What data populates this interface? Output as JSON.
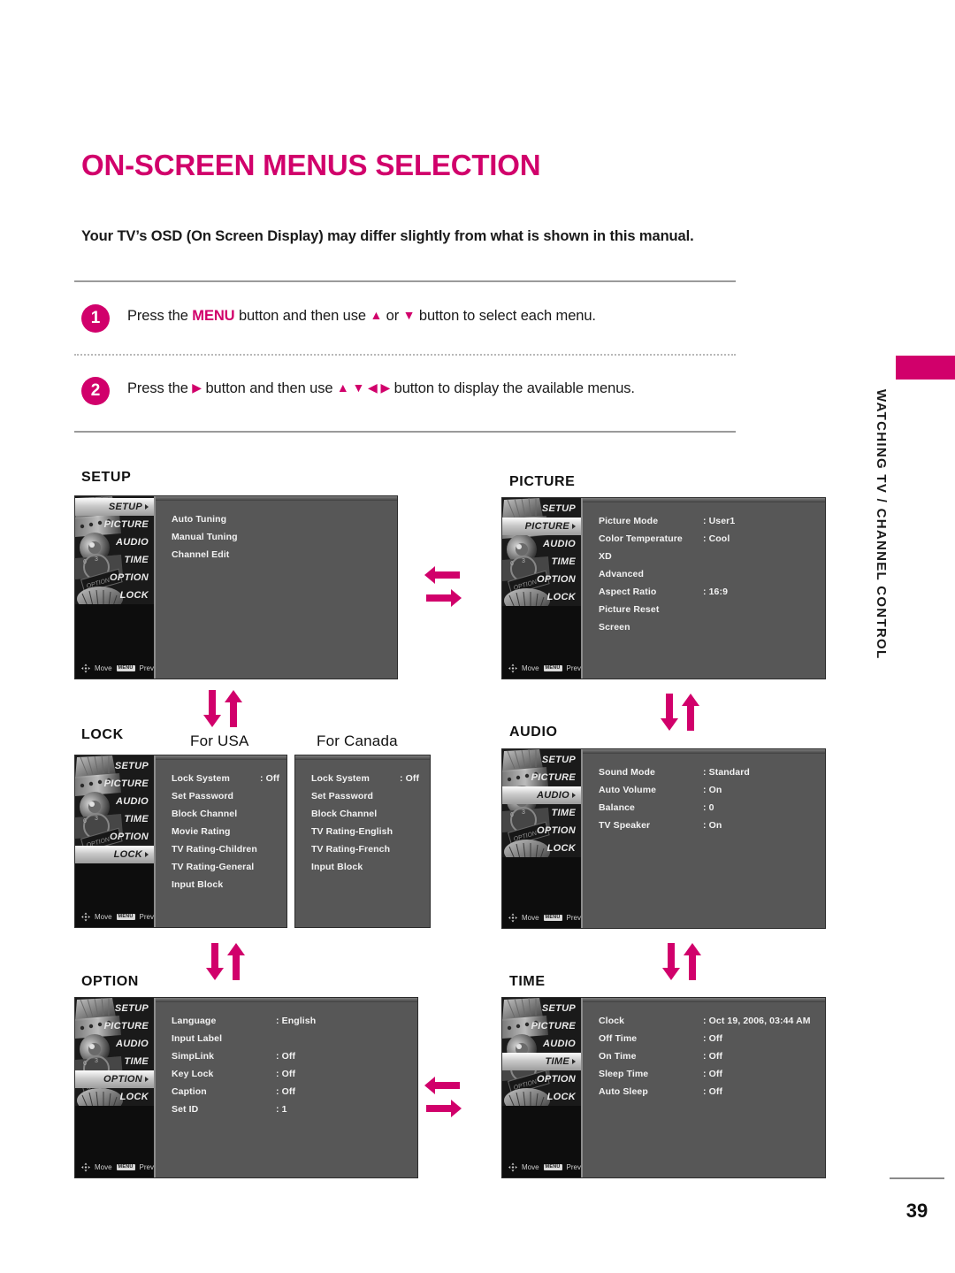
{
  "document": {
    "title": "ON-SCREEN MENUS SELECTION",
    "subtitle": "Your TV’s OSD (On Screen Display) may differ slightly from what is shown in this manual.",
    "page_number": "39",
    "side_tab_text": "WATCHING TV / CHANNEL CONTROL",
    "accent_color": "#D1006B"
  },
  "steps": [
    {
      "number": "1",
      "pre": "Press the ",
      "keyword": "MENU",
      "mid": " button and then use ",
      "icons_a": "▲",
      "mid2": " or ",
      "icons_b": "▼",
      "post": " button to select each menu."
    },
    {
      "number": "2",
      "pre": "Press the ",
      "keyword": "▶",
      "mid": " button and then use ",
      "icons_a": "▲ ▼ ◀ ▶",
      "mid2": "",
      "icons_b": "",
      "post": " button to display the available menus."
    }
  ],
  "osd_common": {
    "sidebar_items": [
      "SETUP",
      "PICTURE",
      "AUDIO",
      "TIME",
      "OPTION",
      "LOCK"
    ],
    "footer_move": "Move",
    "footer_menu_chip": "MENU",
    "footer_prev": "Prev"
  },
  "panels": {
    "setup": {
      "label": "SETUP",
      "selected": "SETUP",
      "rows": [
        {
          "key": "Auto Tuning",
          "value": ""
        },
        {
          "key": "Manual Tuning",
          "value": ""
        },
        {
          "key": "Channel Edit",
          "value": ""
        }
      ]
    },
    "picture": {
      "label": "PICTURE",
      "selected": "PICTURE",
      "rows": [
        {
          "key": "Picture Mode",
          "value": ": User1"
        },
        {
          "key": "Color Temperature",
          "value": ": Cool"
        },
        {
          "key": "XD",
          "value": ""
        },
        {
          "key": "Advanced",
          "value": ""
        },
        {
          "key": "Aspect Ratio",
          "value": ": 16:9"
        },
        {
          "key": "Picture Reset",
          "value": ""
        },
        {
          "key": "Screen",
          "value": ""
        }
      ]
    },
    "lock_usa": {
      "label": "LOCK",
      "sub_label": "For USA",
      "selected": "LOCK",
      "rows": [
        {
          "key": "Lock System",
          "value": ": Off"
        },
        {
          "key": "Set Password",
          "value": ""
        },
        {
          "key": "Block Channel",
          "value": ""
        },
        {
          "key": "Movie Rating",
          "value": ""
        },
        {
          "key": "TV Rating-Children",
          "value": ""
        },
        {
          "key": "TV Rating-General",
          "value": ""
        },
        {
          "key": "Input Block",
          "value": ""
        }
      ]
    },
    "lock_canada": {
      "sub_label": "For Canada",
      "rows": [
        {
          "key": "Lock System",
          "value": ": Off"
        },
        {
          "key": "Set Password",
          "value": ""
        },
        {
          "key": "Block Channel",
          "value": ""
        },
        {
          "key": "TV Rating-English",
          "value": ""
        },
        {
          "key": "TV Rating-French",
          "value": ""
        },
        {
          "key": "Input Block",
          "value": ""
        }
      ]
    },
    "audio": {
      "label": "AUDIO",
      "selected": "AUDIO",
      "rows": [
        {
          "key": "Sound Mode",
          "value": ": Standard"
        },
        {
          "key": "Auto Volume",
          "value": ": On"
        },
        {
          "key": "Balance",
          "value": ": 0"
        },
        {
          "key": "TV Speaker",
          "value": ": On"
        }
      ]
    },
    "option": {
      "label": "OPTION",
      "selected": "OPTION",
      "rows": [
        {
          "key": "Language",
          "value": ": English"
        },
        {
          "key": "Input Label",
          "value": ""
        },
        {
          "key": "SimpLink",
          "value": ": Off"
        },
        {
          "key": "Key Lock",
          "value": ": Off"
        },
        {
          "key": "Caption",
          "value": ": Off"
        },
        {
          "key": "Set ID",
          "value": ": 1"
        }
      ]
    },
    "time": {
      "label": "TIME",
      "selected": "TIME",
      "rows": [
        {
          "key": "Clock",
          "value": ": Oct 19, 2006, 03:44 AM"
        },
        {
          "key": "Off Time",
          "value": ": Off"
        },
        {
          "key": "On Time",
          "value": ": Off"
        },
        {
          "key": "Sleep Time",
          "value": ": Off"
        },
        {
          "key": "Auto Sleep",
          "value": ": Off"
        }
      ]
    }
  }
}
